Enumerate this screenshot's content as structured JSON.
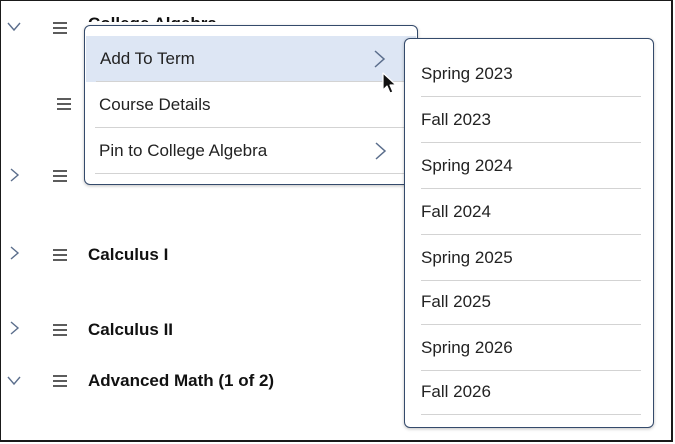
{
  "rows": [
    {
      "label": "College Algebra"
    },
    {
      "label": ""
    },
    {
      "label": ""
    },
    {
      "label": "Calculus I"
    },
    {
      "label": "Calculus II"
    },
    {
      "label": "Advanced Math (1 of 2)"
    }
  ],
  "context_menu": {
    "items": [
      {
        "label": "Add To Term",
        "has_submenu": true,
        "highlighted": true
      },
      {
        "label": "Course Details",
        "has_submenu": false
      },
      {
        "label": "Pin to College Algebra",
        "has_submenu": true
      }
    ]
  },
  "submenu": {
    "items": [
      {
        "label": "Spring 2023"
      },
      {
        "label": "Fall 2023"
      },
      {
        "label": "Spring 2024"
      },
      {
        "label": "Fall 2024"
      },
      {
        "label": "Spring 2025"
      },
      {
        "label": "Fall 2025"
      },
      {
        "label": "Spring 2026"
      },
      {
        "label": "Fall 2026"
      }
    ]
  },
  "icons": {
    "expand": "chevron-right-icon",
    "collapse": "chevron-down-icon",
    "drag": "drag-handle-icon",
    "cursor": "mouse-pointer-icon"
  },
  "colors": {
    "menu_border": "#344a6b",
    "highlight": "#dde6f4",
    "chevron": "#5b6e8c"
  }
}
